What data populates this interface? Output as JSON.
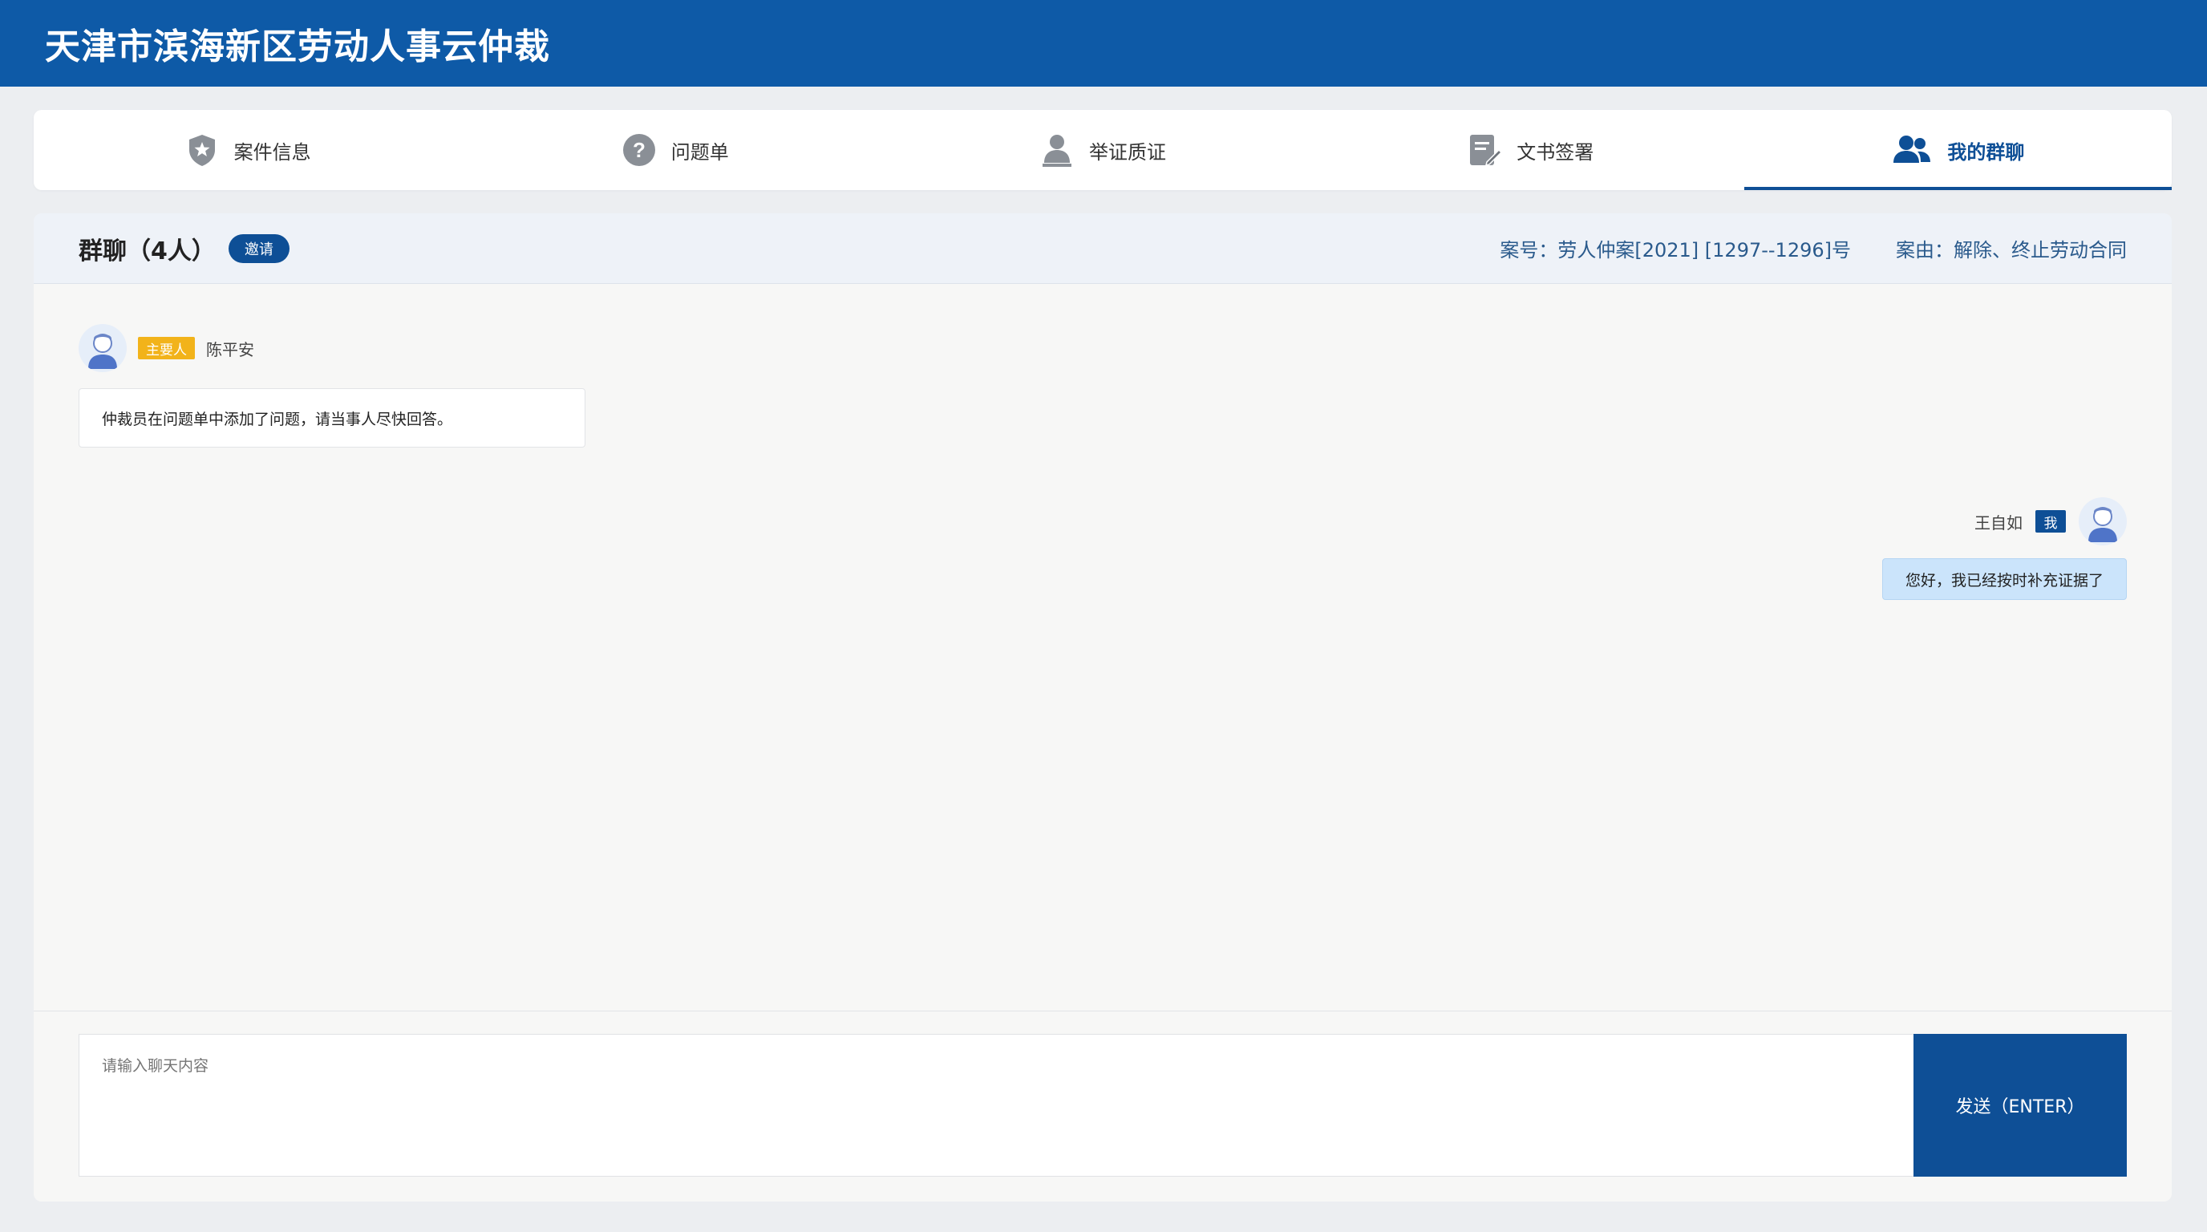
{
  "app": {
    "title": "天津市滨海新区劳动人事云仲裁"
  },
  "tabs": [
    {
      "label": "案件信息",
      "icon": "shield-star-icon"
    },
    {
      "label": "问题单",
      "icon": "question-circle-icon"
    },
    {
      "label": "举证质证",
      "icon": "user-stamp-icon"
    },
    {
      "label": "文书签署",
      "icon": "document-sign-icon"
    },
    {
      "label": "我的群聊",
      "icon": "group-users-icon",
      "active": true
    }
  ],
  "chat": {
    "title": "群聊（4人）",
    "invite_label": "邀请",
    "case_no": "案号：劳人仲案[2021]  [1297--1296]号",
    "case_reason": "案由：解除、终止劳动合同"
  },
  "messages": [
    {
      "side": "left",
      "role_badge": "主要人",
      "sender": "陈平安",
      "text": "仲裁员在问题单中添加了问题，请当事人尽快回答。"
    },
    {
      "side": "right",
      "sender": "王自如",
      "me_badge": "我",
      "text": "您好，我已经按时补充证据了"
    }
  ],
  "composer": {
    "placeholder": "请输入聊天内容",
    "send_label": "发送（ENTER）"
  },
  "colors": {
    "header_bg": "#0e5aa7",
    "accent": "#0e4f96",
    "role_badge": "#f2b31a",
    "my_bubble": "#cbe4fb"
  }
}
